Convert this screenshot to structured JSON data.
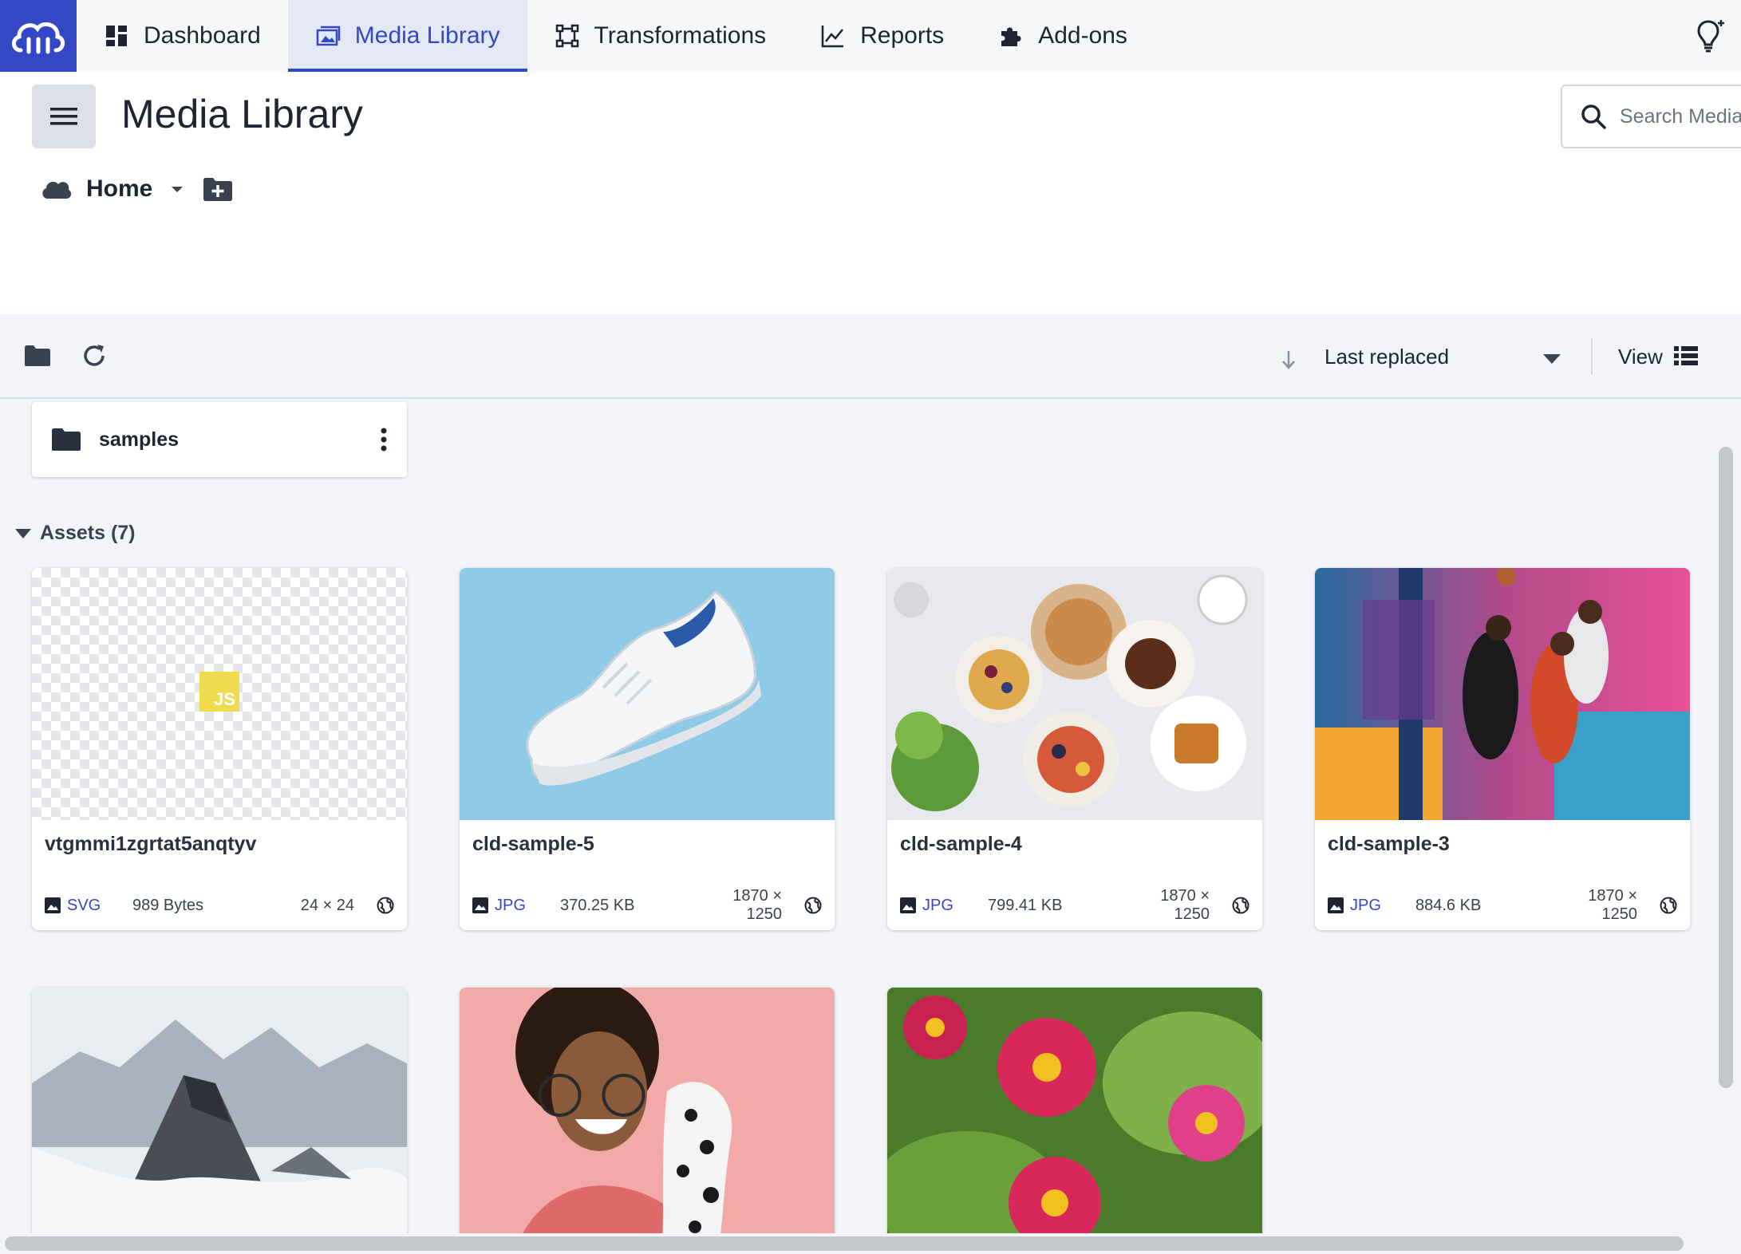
{
  "nav": {
    "items": [
      {
        "label": "Dashboard",
        "icon": "dashboard-icon"
      },
      {
        "label": "Media Library",
        "icon": "media-library-icon",
        "active": true
      },
      {
        "label": "Transformations",
        "icon": "transformations-icon"
      },
      {
        "label": "Reports",
        "icon": "chart-line-icon"
      },
      {
        "label": "Add-ons",
        "icon": "puzzle-icon"
      }
    ],
    "accent": "#3448c5"
  },
  "header": {
    "title": "Media Library",
    "search_placeholder": "Search Media"
  },
  "breadcrumb": {
    "home": "Home"
  },
  "toolbar": {
    "sort_label": "Last replaced",
    "view_label": "View"
  },
  "folders": [
    {
      "name": "samples"
    }
  ],
  "assets": {
    "heading": "Assets (7)",
    "items": [
      {
        "name": "vtgmmi1zgrtat5anqtyv",
        "format": "SVG",
        "size": "989 Bytes",
        "dims": "24 × 24"
      },
      {
        "name": "cld-sample-5",
        "format": "JPG",
        "size": "370.25 KB",
        "dims": "1870 × 1250"
      },
      {
        "name": "cld-sample-4",
        "format": "JPG",
        "size": "799.41 KB",
        "dims": "1870 × 1250"
      },
      {
        "name": "cld-sample-3",
        "format": "JPG",
        "size": "884.6 KB",
        "dims": "1870 × 1250"
      }
    ],
    "svg_badge": "JS"
  }
}
